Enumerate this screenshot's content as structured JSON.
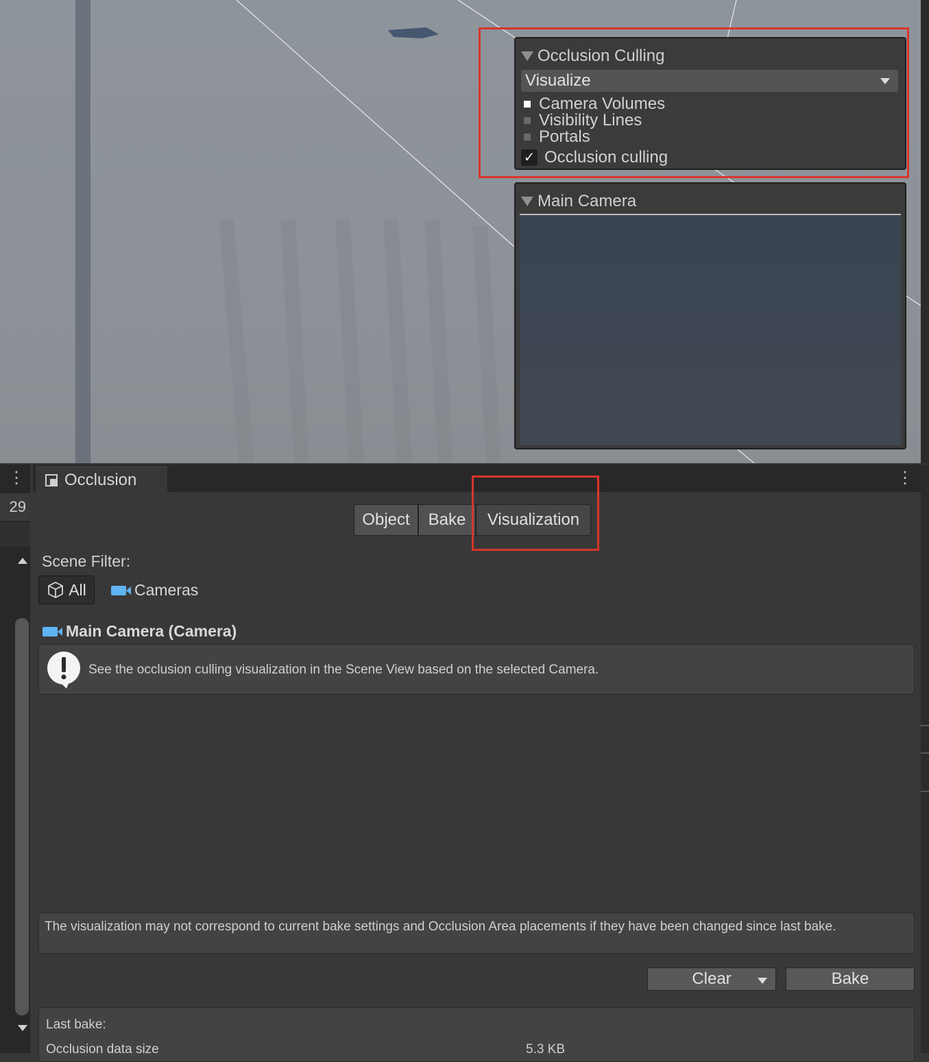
{
  "overlay_occlusion": {
    "title": "Occlusion Culling",
    "mode_value": "Visualize",
    "legend": [
      {
        "label": "Camera Volumes",
        "color": "#ffffff"
      },
      {
        "label": "Visibility Lines",
        "color": "#6a6a6a"
      },
      {
        "label": "Portals",
        "color": "#6a6a6a"
      }
    ],
    "checkbox": {
      "label": "Occlusion culling",
      "checked": true,
      "mark": "✓"
    }
  },
  "overlay_camera": {
    "title": "Main Camera"
  },
  "left_panel": {
    "count": "29"
  },
  "window": {
    "tab_title": "Occlusion",
    "kebab": "⋮",
    "tabs": [
      {
        "label": "Object"
      },
      {
        "label": "Bake"
      },
      {
        "label": "Visualization",
        "selected": true
      }
    ],
    "scene_filter_label": "Scene Filter:",
    "filter_all": "All",
    "filter_cameras": "Cameras",
    "selected_camera": "Main Camera (Camera)",
    "info_text": "See the occlusion culling visualization in the Scene View based on the selected Camera.",
    "warning_text": "The visualization may not correspond to current bake settings and Occlusion Area placements if they have been changed since last bake.",
    "clear_label": "Clear",
    "bake_label": "Bake",
    "last_bake_label": "Last bake:",
    "data_size_label": "Occlusion data size",
    "data_size_value": "5.3 KB"
  }
}
